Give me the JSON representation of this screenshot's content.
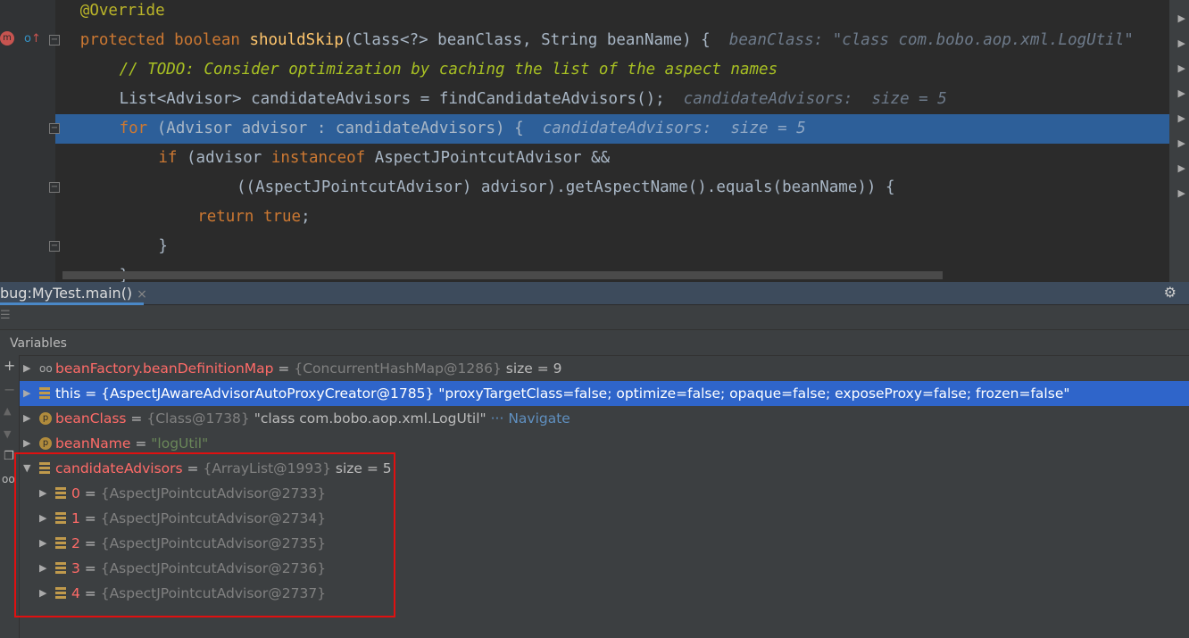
{
  "editor": {
    "lines": [
      {
        "indent": 4,
        "tokens": [
          [
            "ann",
            "@Override"
          ]
        ]
      },
      {
        "indent": 4,
        "tokens": [
          [
            "kw",
            "protected boolean "
          ],
          [
            "fn",
            "shouldSkip"
          ],
          [
            "",
            "(Class<?> beanClass, String beanName) {  "
          ],
          [
            "hint",
            "beanClass: \"class com.bobo.aop.xml.LogUtil\""
          ]
        ]
      },
      {
        "indent": 8,
        "tokens": [
          [
            "cmk",
            "// TODO: Consider optimization by caching the list of the aspect names"
          ]
        ]
      },
      {
        "indent": 8,
        "tokens": [
          [
            "",
            "List<Advisor> candidateAdvisors = findCandidateAdvisors();  "
          ],
          [
            "hint",
            "candidateAdvisors:  size = 5"
          ]
        ]
      },
      {
        "indent": 8,
        "highlight": true,
        "tokens": [
          [
            "kw",
            "for "
          ],
          [
            "",
            "(Advisor advisor : candidateAdvisors) {  "
          ],
          [
            "hint",
            "candidateAdvisors:  size = 5"
          ]
        ]
      },
      {
        "indent": 12,
        "tokens": [
          [
            "kw",
            "if "
          ],
          [
            "",
            "(advisor "
          ],
          [
            "kw",
            "instanceof "
          ],
          [
            "",
            "AspectJPointcutAdvisor &&"
          ]
        ]
      },
      {
        "indent": 20,
        "tokens": [
          [
            "",
            "((AspectJPointcutAdvisor) advisor).getAspectName().equals(beanName)) {"
          ]
        ]
      },
      {
        "indent": 16,
        "tokens": [
          [
            "kw",
            "return true"
          ],
          [
            "",
            ";"
          ]
        ]
      },
      {
        "indent": 12,
        "tokens": [
          [
            "",
            "}"
          ]
        ]
      },
      {
        "indent": 8,
        "tokens": [
          [
            "",
            "}"
          ]
        ]
      }
    ]
  },
  "debug": {
    "tab_label": "bug:MyTest.main()",
    "close": "×",
    "variables_label": "Variables",
    "rows": [
      {
        "icon": "watch",
        "expanded": false,
        "selected": false,
        "name": "beanFactory.beanDefinitionMap",
        "type": "{ConcurrentHashMap@1286}",
        "value": " size = 9"
      },
      {
        "icon": "field",
        "expanded": false,
        "selected": true,
        "name": "this",
        "type": "{AspectJAwareAdvisorAutoProxyCreator@1785}",
        "value": " \"proxyTargetClass=false; optimize=false; opaque=false; exposeProxy=false; frozen=false\""
      },
      {
        "icon": "param",
        "expanded": false,
        "selected": false,
        "name": "beanClass",
        "type": "{Class@1738}",
        "value": " \"class com.bobo.aop.xml.LogUtil\"",
        "nav": " ··· Navigate"
      },
      {
        "icon": "param",
        "expanded": false,
        "selected": false,
        "name": "beanName",
        "type": "",
        "str": "\"logUtil\""
      },
      {
        "icon": "field",
        "expanded": true,
        "selected": false,
        "name": "candidateAdvisors",
        "type": "{ArrayList@1993}",
        "value": "  size = 5"
      },
      {
        "icon": "field",
        "child": true,
        "name": "0",
        "type": "{AspectJPointcutAdvisor@2733}"
      },
      {
        "icon": "field",
        "child": true,
        "name": "1",
        "type": "{AspectJPointcutAdvisor@2734}"
      },
      {
        "icon": "field",
        "child": true,
        "name": "2",
        "type": "{AspectJPointcutAdvisor@2735}"
      },
      {
        "icon": "field",
        "child": true,
        "name": "3",
        "type": "{AspectJPointcutAdvisor@2736}"
      },
      {
        "icon": "field",
        "child": true,
        "name": "4",
        "type": "{AspectJPointcutAdvisor@2737}"
      }
    ]
  },
  "colors": {
    "highlight": "#2d5f99",
    "selection": "#2f65ca",
    "annotation_box": "#e01010"
  }
}
